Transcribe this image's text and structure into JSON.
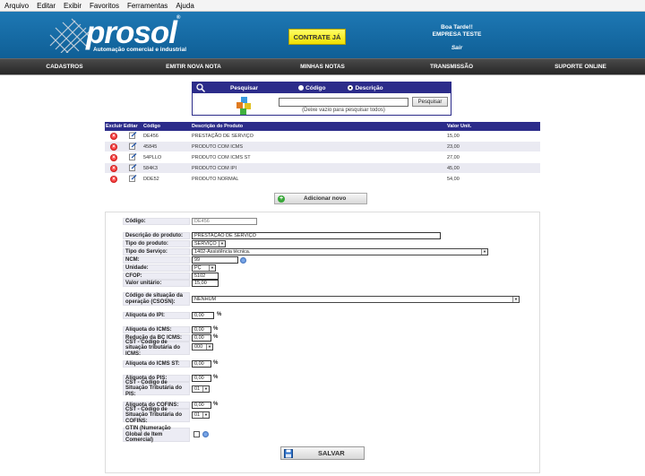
{
  "menubar": [
    "Arquivo",
    "Editar",
    "Exibir",
    "Favoritos",
    "Ferramentas",
    "Ajuda"
  ],
  "header": {
    "logo": "prosol",
    "logo_reg": "®",
    "tagline": "Automação comercial e industrial",
    "contrate_label": "CONTRATE JÁ",
    "greeting": "Boa Tarde!!",
    "company": "EMPRESA TESTE",
    "logout": "Sair",
    "brand_color": "#1e78b4"
  },
  "nav": [
    "CADASTROS",
    "EMITIR NOVA NOTA",
    "MINHAS NOTAS",
    "TRANSMISSÃO",
    "SUPORTE ONLINE"
  ],
  "search": {
    "title": "Pesquisar",
    "opt_codigo": "Código",
    "opt_descricao": "Descrição",
    "selected": "Descrição",
    "query": "",
    "button": "Pesquisar",
    "hint": "(Deixe vazio para pesquisar todos)"
  },
  "table": {
    "headers": [
      "Excluir",
      "Editar",
      "Código",
      "Descrição do Produto",
      "Valor Unit."
    ],
    "rows": [
      {
        "codigo": "DE456",
        "descricao": "PRESTAÇÃO DE SERVIÇO",
        "valor": "15,00"
      },
      {
        "codigo": "45845",
        "descricao": "PRODUTO COM ICMS",
        "valor": "23,00"
      },
      {
        "codigo": "54PLLO",
        "descricao": "PRODUTO COM ICMS ST",
        "valor": "27,00"
      },
      {
        "codigo": "584K3",
        "descricao": "PRODUTO COM IPI",
        "valor": "45,00"
      },
      {
        "codigo": "DDE52",
        "descricao": "PRODUTO NORMAL",
        "valor": "54,00"
      }
    ]
  },
  "add_label": "Adicionar novo",
  "form": {
    "codigo_label": "Código:",
    "codigo": "DE456",
    "descricao_label": "Descrição do produto:",
    "descricao": "PRESTAÇÃO DE SERVIÇO",
    "tipo_label": "Tipo do produto:",
    "tipo": "SERVIÇO",
    "tipo_servico_label": "Tipo do Serviço:",
    "tipo_servico": "1402-Assistência técnica.",
    "ncm_label": "NCM:",
    "ncm": "99",
    "unidade_label": "Unidade:",
    "unidade": "PÇ",
    "cfop_label": "CFOP:",
    "cfop": "5102",
    "valor_label": "Valor unitário:",
    "valor": "15,00",
    "csosn_label": "Código de situação da operação (CSOSN):",
    "csosn": "NENHUM",
    "ipi_label": "Alíquota do IPI:",
    "ipi": "0,00",
    "icms_label": "Alíquota do ICMS:",
    "icms": "0,00",
    "red_label": "Redução da BC ICMS:",
    "red": "0,00",
    "cst_icms_label": "CST - Código de situação tributária do ICMS:",
    "cst_icms": "000",
    "icms_st_label": "Alíquota do ICMS ST:",
    "icms_st": "0,00",
    "pis_label": "Alíquota do PIS:",
    "pis": "0,00",
    "cst_pis_label": "CST - Código de Situação Tributária do PIS:",
    "cst_pis": "01",
    "cofins_label": "Alíquota do COFINS:",
    "cofins": "0,00",
    "cst_cofins_label": "CST - Código de Situação Tributária do COFINS:",
    "cst_cofins": "01",
    "gtin_label": "GTIN (Numeração Global de Item Comercial)",
    "pct": "%",
    "save_label": "SALVAR"
  }
}
